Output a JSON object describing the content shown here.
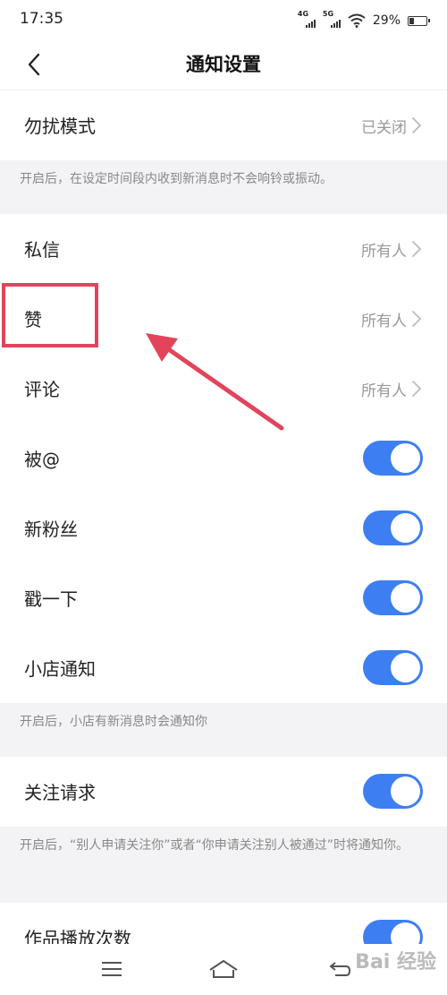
{
  "status_bar": {
    "time": "17:35",
    "net1": "4G",
    "net2": "5G",
    "battery": "29%",
    "battery_level": 0.29
  },
  "header": {
    "title": "通知设置"
  },
  "rows": {
    "dnd": {
      "label": "勿扰模式",
      "value": "已关闭"
    },
    "dnd_hint": "开启后，在设定时间段内收到新消息时不会响铃或振动。",
    "dm": {
      "label": "私信",
      "value": "所有人"
    },
    "likes": {
      "label": "赞",
      "value": "所有人"
    },
    "comments": {
      "label": "评论",
      "value": "所有人"
    },
    "mentions": {
      "label": "被@",
      "enabled": true
    },
    "new_fans": {
      "label": "新粉丝",
      "enabled": true
    },
    "poke": {
      "label": "戳一下",
      "enabled": true
    },
    "shop": {
      "label": "小店通知",
      "enabled": true
    },
    "shop_hint": "开启后，小店有新消息时会通知你",
    "follow_request": {
      "label": "关注请求",
      "enabled": true
    },
    "follow_hint": "开启后，“别人申请关注你”或者“你申请关注别人被通过”时将通知你。",
    "play_count": {
      "label": "作品播放次数",
      "enabled": true
    }
  },
  "colors": {
    "toggle_on": "#3d7ff2",
    "annotation": "#e2445c"
  },
  "watermark": "Bai 经验"
}
